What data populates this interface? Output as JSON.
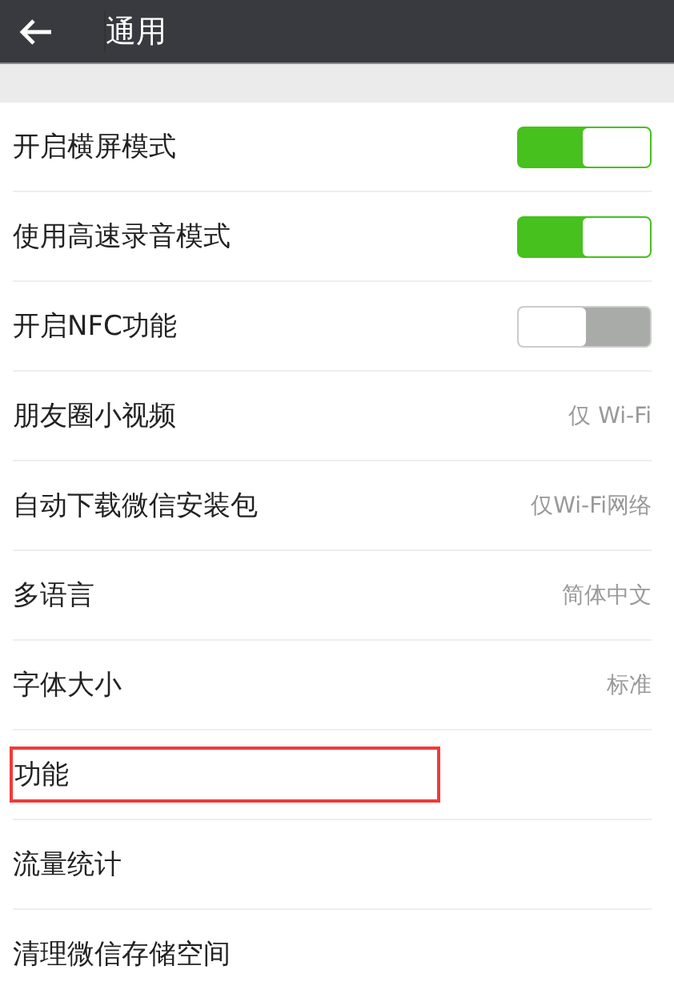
{
  "header": {
    "title": "通用"
  },
  "rows": [
    {
      "label": "开启横屏模式",
      "kind": "toggle",
      "on": true
    },
    {
      "label": "使用高速录音模式",
      "kind": "toggle",
      "on": true
    },
    {
      "label": "开启NFC功能",
      "kind": "toggle",
      "on": false
    },
    {
      "label": "朋友圈小视频",
      "kind": "value",
      "value": "仅 Wi-Fi"
    },
    {
      "label": "自动下载微信安装包",
      "kind": "value",
      "value": "仅Wi-Fi网络"
    },
    {
      "label": "多语言",
      "kind": "value",
      "value": "简体中文"
    },
    {
      "label": "字体大小",
      "kind": "value",
      "value": "标准"
    },
    {
      "label": "功能",
      "kind": "plain",
      "highlighted": true
    },
    {
      "label": "流量统计",
      "kind": "plain",
      "highlighted": false
    },
    {
      "label": "清理微信存储空间",
      "kind": "plain",
      "highlighted": false
    }
  ]
}
